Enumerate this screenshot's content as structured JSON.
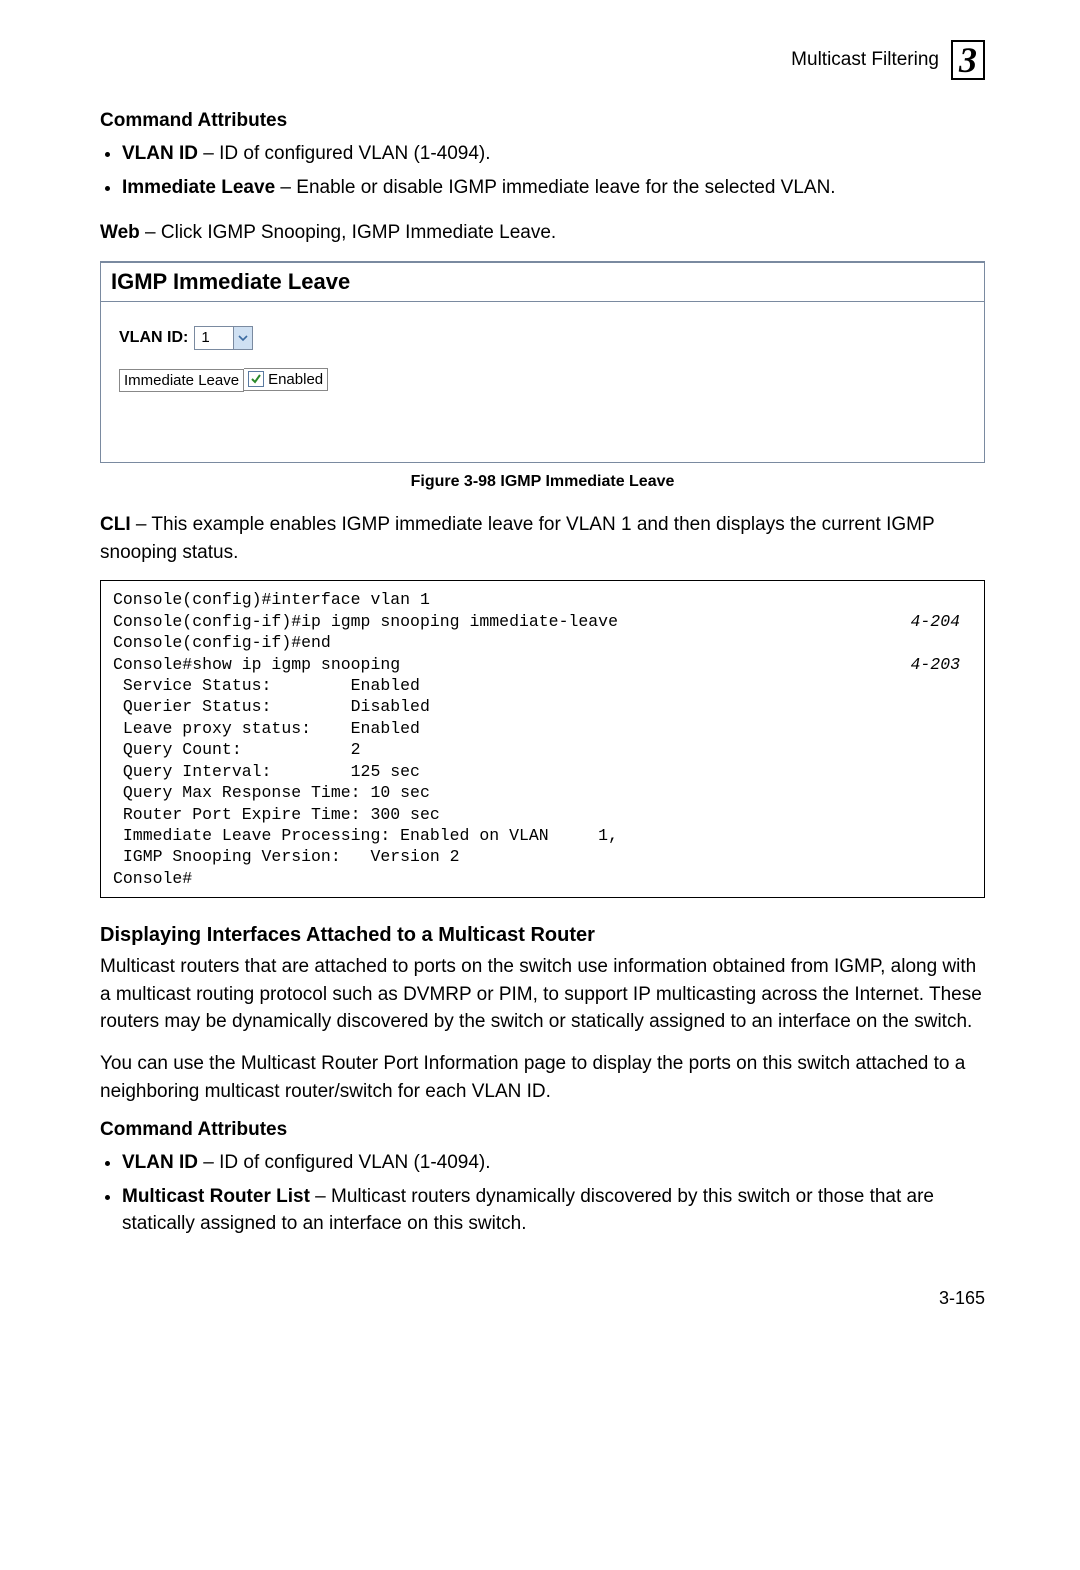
{
  "header": {
    "title": "Multicast Filtering",
    "chapter": "3"
  },
  "section1": {
    "heading": "Command Attributes",
    "items": [
      {
        "term": "VLAN ID",
        "desc": " – ID of configured VLAN (1-4094)."
      },
      {
        "term": "Immediate Leave",
        "desc": " – Enable or disable IGMP immediate leave for the selected VLAN."
      }
    ]
  },
  "web_para": {
    "lead": "Web",
    "text": " – Click IGMP Snooping, IGMP Immediate Leave."
  },
  "ui": {
    "title": "IGMP Immediate Leave",
    "vlan_label": "VLAN ID:",
    "vlan_value": "1",
    "imm_label": "Immediate Leave",
    "enabled_label": "Enabled",
    "enabled_checked": true
  },
  "figure_caption": "Figure 3-98  IGMP Immediate Leave",
  "cli_para": {
    "lead": "CLI",
    "text": " – This example enables IGMP immediate leave for VLAN 1 and then displays the current IGMP snooping status."
  },
  "cli": {
    "lines": [
      "Console(config)#interface vlan 1",
      "Console(config-if)#ip igmp snooping immediate-leave",
      "Console(config-if)#end",
      "Console#show ip igmp snooping",
      " Service Status:        Enabled",
      " Querier Status:        Disabled",
      " Leave proxy status:    Enabled",
      " Query Count:           2",
      " Query Interval:        125 sec",
      " Query Max Response Time: 10 sec",
      " Router Port Expire Time: 300 sec",
      " Immediate Leave Processing: Enabled on VLAN     1,",
      " IGMP Snooping Version:   Version 2",
      "Console#"
    ],
    "refs": {
      "1": "4-204",
      "3": "4-203"
    }
  },
  "section2": {
    "heading": "Displaying Interfaces Attached to a Multicast Router",
    "p1": "Multicast routers that are attached to ports on the switch use information obtained from IGMP, along with a multicast routing protocol such as DVMRP or PIM, to support IP multicasting across the Internet. These routers may be dynamically discovered by the switch or statically assigned to an interface on the switch.",
    "p2": "You can use the Multicast Router Port Information page to display the ports on this switch attached to a neighboring multicast router/switch for each VLAN ID."
  },
  "section3": {
    "heading": "Command Attributes",
    "items": [
      {
        "term": "VLAN ID",
        "desc": " – ID of configured VLAN (1-4094)."
      },
      {
        "term": "Multicast Router List",
        "desc": " – Multicast routers dynamically discovered by this switch or those that are statically assigned to an interface on this switch."
      }
    ]
  },
  "page_number": "3-165"
}
